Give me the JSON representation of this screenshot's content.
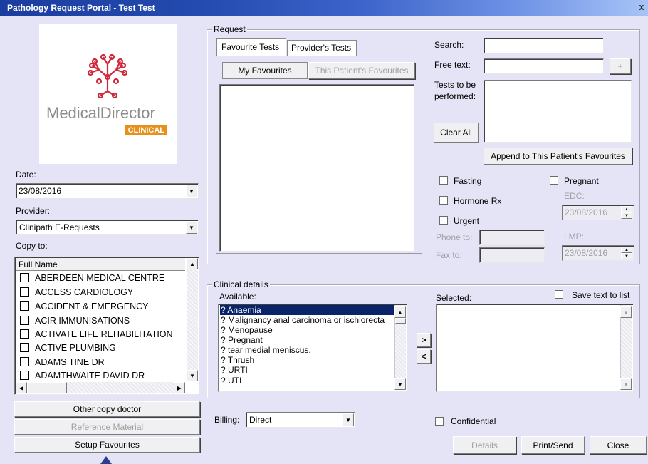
{
  "window": {
    "title": "Pathology Request Portal - Test Test",
    "close_glyph": "x"
  },
  "logo": {
    "brand": "MedicalDirector",
    "badge": "CLINICAL"
  },
  "left": {
    "date_label": "Date:",
    "date_value": "23/08/2016",
    "provider_label": "Provider:",
    "provider_value": "Clinipath E-Requests",
    "copy_label": "Copy to:",
    "copy_header": "Full Name",
    "copy_items": [
      "ABERDEEN MEDICAL CENTRE",
      "ACCESS CARDIOLOGY",
      "ACCIDENT & EMERGENCY",
      "ACIR IMMUNISATIONS",
      "ACTIVATE LIFE REHABILITATION",
      "ACTIVE PLUMBING",
      "ADAMS TINE DR",
      "ADAMTHWAITE DAVID DR"
    ],
    "other_copy_button": "Other copy doctor",
    "reference_button": "Reference Material",
    "setup_button": "Setup Favourites"
  },
  "request": {
    "group_title": "Request",
    "tabs": [
      "Favourite Tests",
      "Provider's Tests"
    ],
    "subtabs": [
      "My Favourites",
      "This Patient's Favourites"
    ],
    "search_label": "Search:",
    "free_text_label": "Free text:",
    "plus_button": "+",
    "tests_label_line1": "Tests to be",
    "tests_label_line2": "performed:",
    "clear_all_button": "Clear All",
    "append_button": "Append to This Patient's Favourites",
    "fasting_label": "Fasting",
    "hormone_label": "Hormone Rx",
    "urgent_label": "Urgent",
    "pregnant_label": "Pregnant",
    "edc_label": "EDC:",
    "edc_value": "23/08/2016",
    "lmp_label": "LMP:",
    "lmp_value": "23/08/2016",
    "phone_label": "Phone to:",
    "fax_label": "Fax to:"
  },
  "clinical": {
    "group_title": "Clinical details",
    "available_label": "Available:",
    "selected_label": "Selected:",
    "save_text_label": "Save text to list",
    "available_items": [
      "? Anaemia",
      "? Malignancy anal  carcinoma  or ischiorecta",
      "? Menopause",
      "? Pregnant",
      "? tear  medial meniscus.",
      "? Thrush",
      "? URTI",
      "? UTI"
    ],
    "move_right": ">",
    "move_left": "<"
  },
  "bottom": {
    "billing_label": "Billing:",
    "billing_value": "Direct",
    "confidential_label": "Confidential",
    "details_button": "Details",
    "print_button": "Print/Send",
    "close_button": "Close"
  }
}
